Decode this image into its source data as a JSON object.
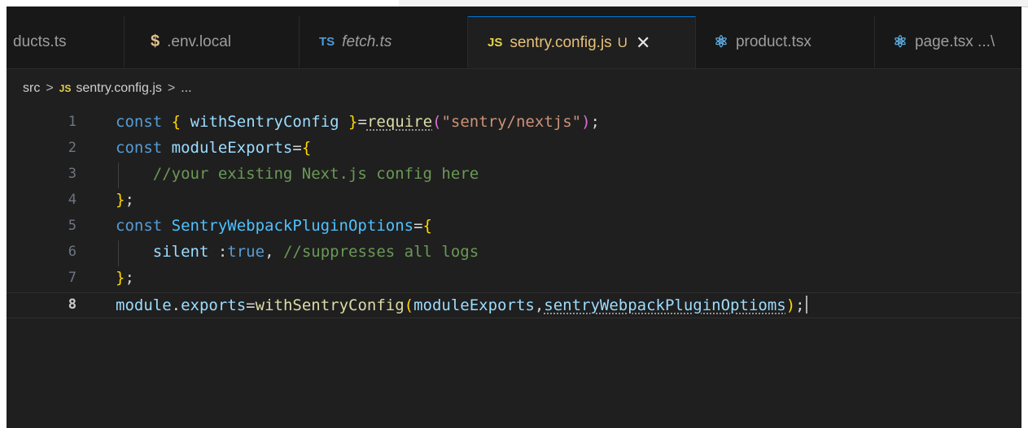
{
  "tabs": [
    {
      "label": "ducts.ts",
      "icon": "",
      "italic": false
    },
    {
      "label": ".env.local",
      "icon": "$",
      "icon_name": "dollar-icon",
      "italic": false
    },
    {
      "label": "fetch.ts",
      "icon": "TS",
      "icon_name": "typescript-icon",
      "italic": true
    },
    {
      "label": "sentry.config.js",
      "icon": "JS",
      "icon_name": "javascript-icon",
      "modified": "U",
      "close": "✕",
      "active": true
    },
    {
      "label": "product.tsx",
      "icon": "⚛",
      "icon_name": "react-icon"
    },
    {
      "label": "page.tsx ...\\",
      "icon": "⚛",
      "icon_name": "react-icon"
    }
  ],
  "breadcrumb": {
    "folder": "src",
    "sep": ">",
    "file_icon": "JS",
    "file": "sentry.config.js",
    "tail": "..."
  },
  "editor": {
    "current_line": 8,
    "line_numbers": [
      "1",
      "2",
      "3",
      "4",
      "5",
      "6",
      "7",
      "8"
    ],
    "code": {
      "l1": {
        "kw": "const",
        "b1": "{",
        "name": "withSentryConfig",
        "b2": "}",
        "eq": "=",
        "req": "require",
        "p1": "(",
        "str": "\"sentry/nextjs\"",
        "p2": ")",
        "semi": ";"
      },
      "l2": {
        "kw": "const",
        "name": "moduleExports",
        "eq": "=",
        "b": "{"
      },
      "l3": {
        "comment": "//your existing Next.js config here"
      },
      "l4": {
        "b": "}",
        "semi": ";"
      },
      "l5": {
        "kw": "const",
        "name": "SentryWebpackPluginOptions",
        "eq": "=",
        "b": "{"
      },
      "l6": {
        "prop": "silent",
        "colon": " :",
        "val": "true",
        "comma": ", ",
        "comment": "//suppresses all logs"
      },
      "l7": {
        "b": "}",
        "semi": ";"
      },
      "l8": {
        "obj": "module",
        "dot": ".",
        "prop": "exports",
        "eq": "=",
        "fn": "withSentryConfig",
        "p1": "(",
        "arg1": "moduleExports",
        "comma": ",",
        "arg2": "sentryWebpackPluginOptioms",
        "p2": ")",
        "semi": ";"
      }
    }
  }
}
